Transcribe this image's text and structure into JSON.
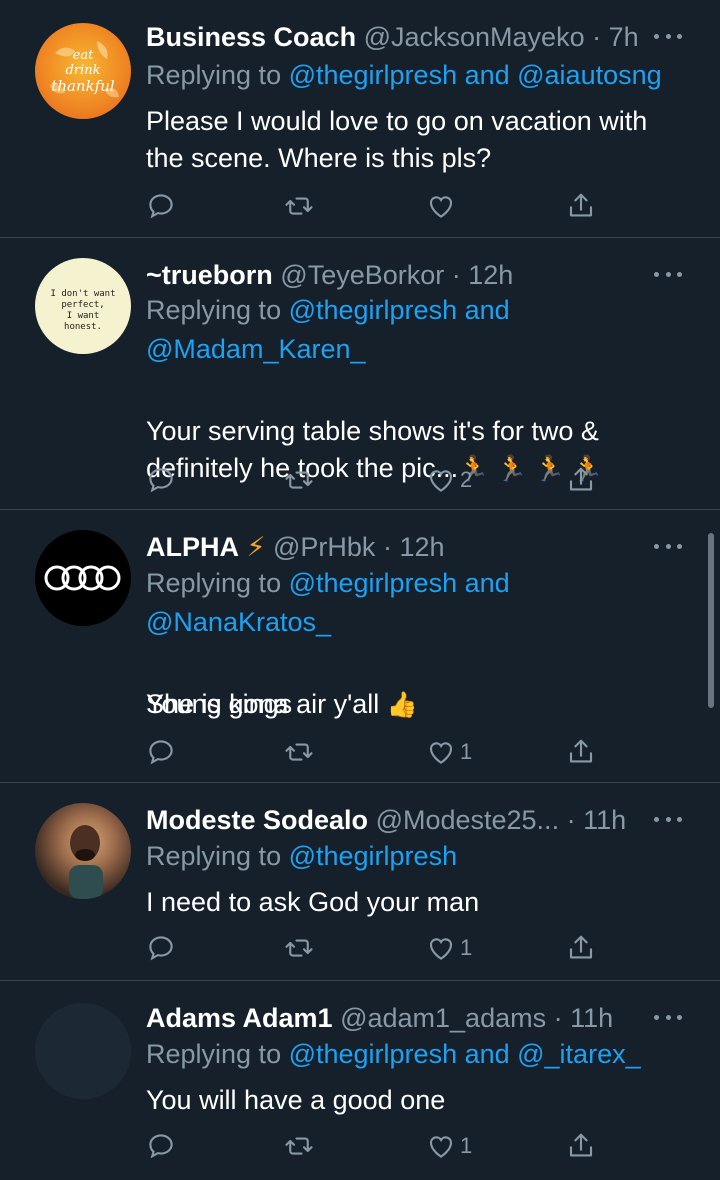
{
  "tweets": [
    {
      "name": "Business Coach",
      "handle": "@JacksonMayeko",
      "time": "· 7h",
      "reply_prefix": "Replying to ",
      "reply_mentions": "@thegirlpresh and @aiautosng",
      "reply_mentions_2": "",
      "text": "Please I would love to go on vacation with\nthe scene. Where is this pls?",
      "like_count": "",
      "avatar": {
        "type": "leaf",
        "text": "eat\ndrink\nthankful"
      }
    },
    {
      "name": "~trueborn",
      "handle": "@TeyeBorkor",
      "time": "· 12h",
      "reply_prefix": "Replying to ",
      "reply_mentions": "@thegirlpresh and",
      "reply_mentions_2": "@Madam_Karen_",
      "text": "Your serving table shows it's for two &\ndefinitely he took the pic...",
      "emoji_suffix": "🏃 🏃 🏃 🏃",
      "like_count": "2",
      "avatar": {
        "type": "quote",
        "text": "I don't want\nperfect,\nI want\nhonest."
      }
    },
    {
      "name": "ALPHA",
      "name_emoji": "⚡",
      "handle": "@PrHbk",
      "time": "· 12h",
      "reply_prefix": "Replying to ",
      "reply_mentions": "@thegirlpresh and",
      "reply_mentions_2": "@NanaKratos_",
      "text": "She is gona air y'all",
      "emoji_suffix": "👍",
      "text_line2": "Young kings",
      "like_count": "1",
      "avatar": {
        "type": "rings"
      }
    },
    {
      "name": "Modeste Sodealo",
      "handle": "@Modeste25...",
      "time": "· 11h",
      "reply_prefix": "Replying to ",
      "reply_mentions": "@thegirlpresh",
      "reply_mentions_2": "",
      "text": "I need to ask God your man",
      "like_count": "1",
      "avatar": {
        "type": "photo"
      }
    },
    {
      "name": "Adams Adam1",
      "handle": "@adam1_adams",
      "time": "· 11h",
      "reply_prefix": "Replying to ",
      "reply_mentions": "@thegirlpresh and @_itarex_",
      "reply_mentions_2": "",
      "text": "You will have a good one",
      "like_count": "1",
      "avatar": {
        "type": "blank"
      }
    }
  ],
  "icons": [
    "reply-icon",
    "retweet-icon",
    "like-icon",
    "share-icon",
    "more-icon"
  ],
  "colors": {
    "background": "#15202b",
    "secondary_text": "#8899a6",
    "mention": "#1da1f2",
    "divider": "#38444d"
  }
}
